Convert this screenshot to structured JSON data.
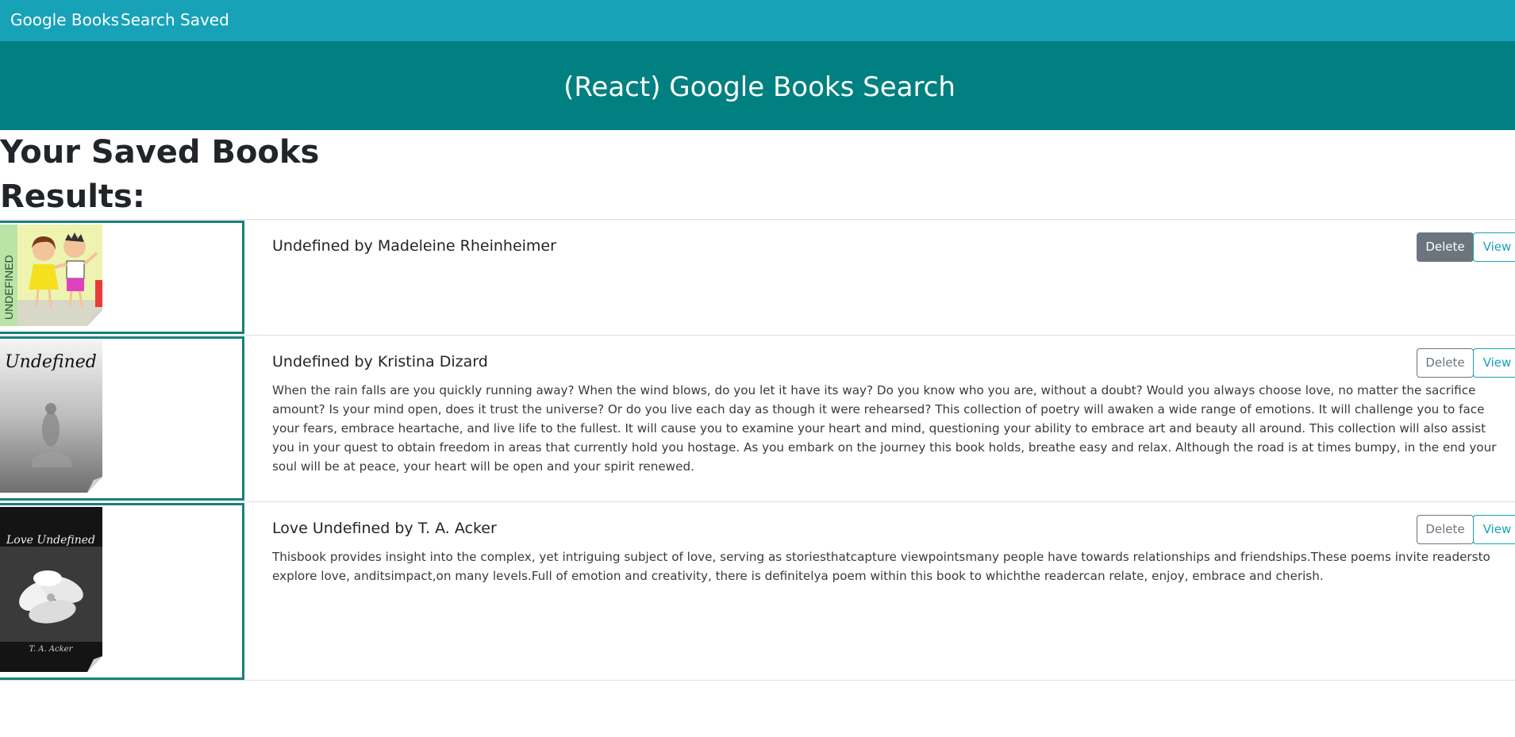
{
  "navbar": {
    "brand": "Google Books",
    "links": [
      "Search",
      "Saved"
    ]
  },
  "jumbotron": {
    "title": "(React) Google Books Search"
  },
  "page": {
    "heading": "Your Saved Books",
    "results_label": "Results:"
  },
  "books": [
    {
      "title": "Undefined by Madeleine Rheinheimer",
      "description": "",
      "cover_icon": "cartoon-kids-cover",
      "delete_label": "Delete",
      "view_label": "View"
    },
    {
      "title": "Undefined by Kristina Dizard",
      "description": "When the rain falls are you quickly running away? When the wind blows, do you let it have its way? Do you know who you are, without a doubt? Would you always choose love, no matter the sacrifice amount? Is your mind open, does it trust the universe? Or do you live each day as though it were rehearsed? This collection of poetry will awaken a wide range of emotions. It will challenge you to face your fears, embrace heartache, and live life to the fullest. It will cause you to examine your heart and mind, questioning your ability to embrace art and beauty all around. This collection will also assist you in your quest to obtain freedom in areas that currently hold you hostage. As you embark on the journey this book holds, breathe easy and relax. Although the road is at times bumpy, in the end your soul will be at peace, your heart will be open and your spirit renewed.",
      "cover_icon": "misty-figure-cover",
      "cover_text": "Undefined",
      "delete_label": "Delete",
      "view_label": "View"
    },
    {
      "title": "Love Undefined by T. A. Acker",
      "description": "Thisbook provides insight into the complex, yet intriguing subject of love, serving as storiesthatcapture viewpointsmany people have towards relationships and friendships.These poems invite readersto explore love, anditsimpact,on many levels.Full of emotion and creativity, there is definitelya poem within this book to whichthe readercan relate, enjoy, embrace and cherish.",
      "cover_icon": "white-flower-cover",
      "cover_text": "Love Undefined",
      "cover_author": "T. A. Acker",
      "delete_label": "Delete",
      "view_label": "View"
    }
  ],
  "colors": {
    "navbar": "#17a2b8",
    "jumbotron": "#008080",
    "thumb_border": "#1a7f7a",
    "delete": "#6c757d",
    "view": "#17a2b8"
  }
}
